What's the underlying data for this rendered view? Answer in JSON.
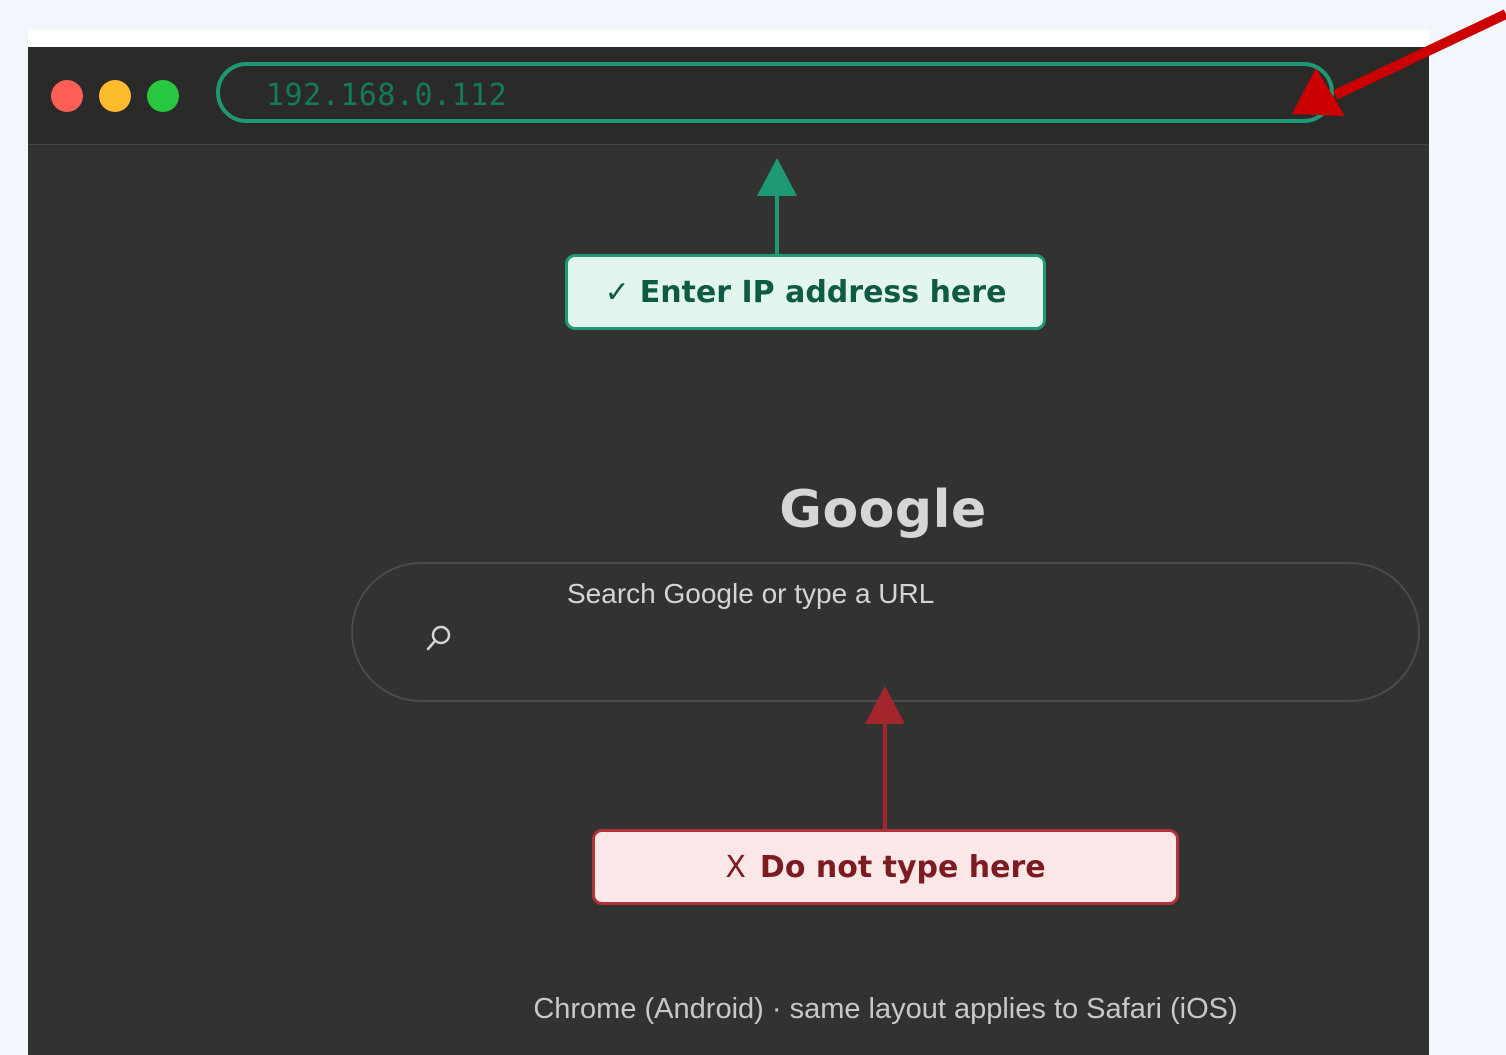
{
  "browser": {
    "window_controls": [
      "close",
      "minimize",
      "maximize"
    ],
    "address_bar": {
      "value": "192.168.0.112"
    }
  },
  "callouts": {
    "correct": {
      "mark": "✓",
      "text": "Enter IP address here"
    },
    "wrong": {
      "mark": "X",
      "text": "Do not type here"
    }
  },
  "page": {
    "logo": "Google",
    "search_placeholder": "Search Google or type a URL"
  },
  "footer": {
    "caption": "Chrome (Android) · same layout applies to Safari (iOS)"
  },
  "colors": {
    "correct_accent": "#1d9a75",
    "wrong_accent": "#a3262d",
    "pointer_arrow": "#cc0000"
  },
  "icons": [
    "search-icon"
  ]
}
